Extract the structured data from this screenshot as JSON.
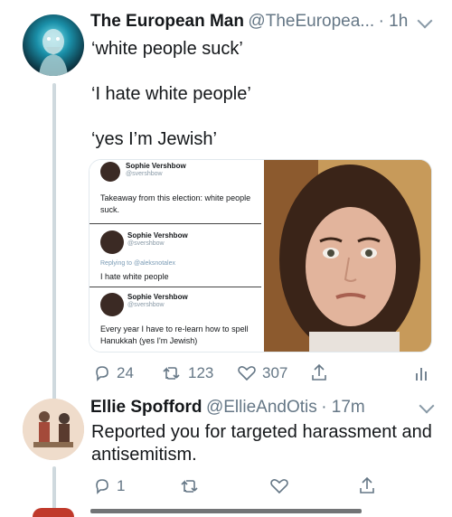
{
  "tweet1": {
    "display_name": "The European Man",
    "handle": "@TheEuropea...",
    "dot_time": "· 1h",
    "lines": [
      "‘white people suck’",
      "‘I hate white people’",
      "‘yes I’m Jewish’"
    ],
    "embedded": {
      "t1_name": "Sophie Vershbow",
      "t1_handle": "@svershbow",
      "t1_text": "Takeaway from this election: white people suck.",
      "t2_name": "Sophie Vershbow",
      "t2_handle": "@svershbow",
      "t2_reply": "Replying to @aleksnotalex",
      "t2_text": "I hate white people",
      "t3_name": "Sophie Vershbow",
      "t3_handle": "@svershbow",
      "t3_text": "Every year I have to re-learn how to spell Hanukkah (yes I'm Jewish)"
    },
    "replies": "24",
    "retweets": "123",
    "likes": "307"
  },
  "tweet2": {
    "display_name": "Ellie Spofford",
    "handle": "@EllieAndOtis",
    "dot_time": "· 17m",
    "text": "Reported you for targeted harassment and antisemitism.",
    "replies": "1",
    "retweets": "",
    "likes": ""
  },
  "colors": {
    "text": "#14171a",
    "muted": "#657786",
    "thread_line": "#cfd9de"
  }
}
